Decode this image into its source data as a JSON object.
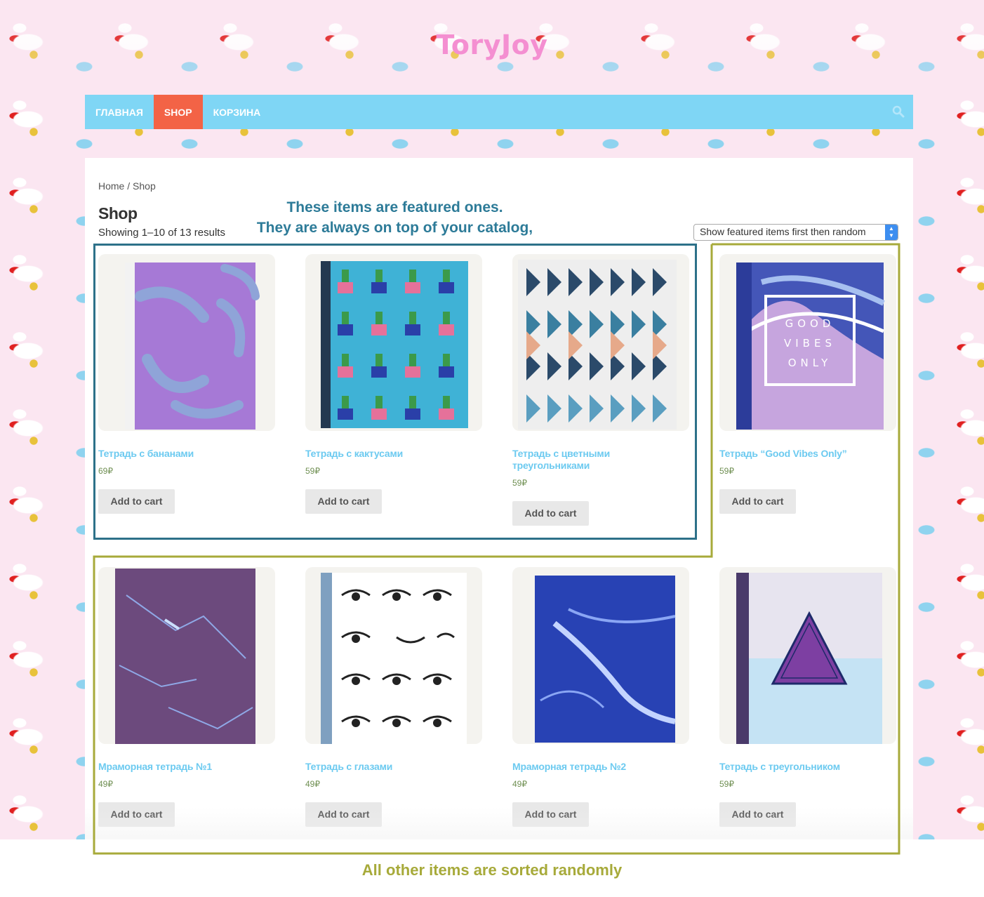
{
  "site": {
    "title": "ToryJoy"
  },
  "nav": {
    "items": [
      {
        "label": "ГЛАВНАЯ",
        "active": false
      },
      {
        "label": "SHOP",
        "active": true
      },
      {
        "label": "КОРЗИНА",
        "active": false
      }
    ],
    "search_icon": "search-icon"
  },
  "breadcrumb": {
    "home": "Home",
    "separator": " / ",
    "current": "Shop"
  },
  "page": {
    "title": "Shop",
    "result_count": "Showing 1–10 of 13 results",
    "sort_selected": "Show featured items first then random"
  },
  "products": [
    {
      "title": "Тетрадь с бананами",
      "price": "69₽",
      "button": "Add to cart"
    },
    {
      "title": "Тетрадь с кактусами",
      "price": "59₽",
      "button": "Add to cart"
    },
    {
      "title": "Тетрадь с цветными треугольниками",
      "price": "59₽",
      "button": "Add to cart"
    },
    {
      "title": "Тетрадь “Good Vibes Only”",
      "price": "59₽",
      "button": "Add to cart"
    },
    {
      "title": "Мраморная тетрадь №1",
      "price": "49₽",
      "button": "Add to cart"
    },
    {
      "title": "Тетрадь с глазами",
      "price": "49₽",
      "button": "Add to cart"
    },
    {
      "title": "Мраморная тетрадь №2",
      "price": "49₽",
      "button": "Add to cart"
    },
    {
      "title": "Тетрадь с треугольником",
      "price": "59₽",
      "button": "Add to cart"
    }
  ],
  "annotations": {
    "featured_line1": "These items are featured ones.",
    "featured_line2": "They are always on top of your catalog,",
    "random": "All other items are sorted randomly"
  },
  "colors": {
    "nav_bg": "#7fd6f5",
    "nav_active": "#f36346",
    "title_pink": "#f48fd1",
    "product_title": "#6ccaf0",
    "price_green": "#6f8f52",
    "featured_annotation": "#2d7189",
    "random_annotation": "#a7aa3a"
  },
  "notebook_art": {
    "p0_cover_text": "",
    "p3_cover_text": [
      "GOOD",
      "VIBES",
      "ONLY"
    ]
  }
}
